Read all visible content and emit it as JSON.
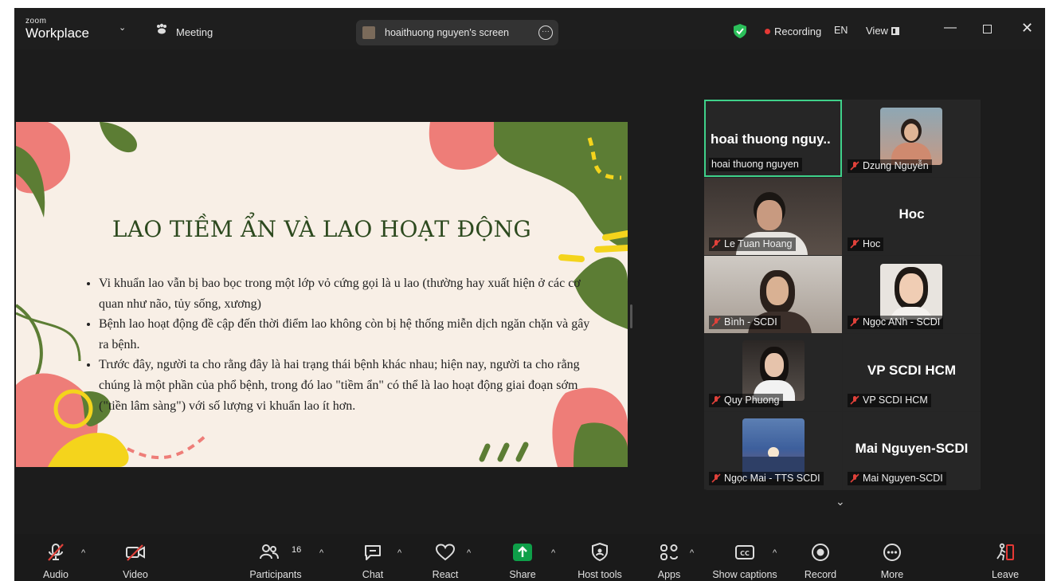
{
  "app": {
    "logo_small": "zoom",
    "logo_big": "Workplace",
    "meeting_label": "Meeting",
    "share_status": "hoaithuong nguyen's screen",
    "recording_label": "Recording",
    "language": "EN",
    "view_label": "View"
  },
  "slide": {
    "title": "LAO TIỀM ẨN VÀ LAO HOẠT ĐỘNG",
    "bullets": [
      "Vi khuẩn lao vẫn bị bao bọc trong một lớp vỏ cứng gọi là u lao (thường hay xuất hiện ở các cơ quan như não, tủy sống, xương)",
      "Bệnh lao hoạt động đề cập đến thời điểm lao không còn bị hệ thống miễn dịch ngăn chặn và gây ra bệnh.",
      "Trước đây, người ta cho rằng đây là hai trạng thái bệnh khác nhau; hiện nay, người ta cho rằng chúng là một phần của phổ bệnh, trong đó lao \"tiềm ẩn\" có thể là lao hoạt động giai đoạn sớm (\"tiền lâm sàng\") với số lượng vi khuẩn lao ít hơn."
    ]
  },
  "participants": [
    {
      "name": "hoai thuong nguyen",
      "namecard": "hoai thuong nguy..",
      "muted": false,
      "active": true
    },
    {
      "name": "Dzung Nguyễn",
      "muted": true
    },
    {
      "name": "Le Tuan Hoang",
      "muted": true
    },
    {
      "name": "Hoc",
      "namecard": "Hoc",
      "muted": true
    },
    {
      "name": "Bình - SCDI",
      "muted": true
    },
    {
      "name": "Ngọc ANh - SCDI",
      "muted": true
    },
    {
      "name": "Quy Phuong",
      "muted": true
    },
    {
      "name": "VP SCDI HCM",
      "namecard": "VP SCDI HCM",
      "muted": true
    },
    {
      "name": "Ngọc Mai - TTS SCDI",
      "muted": true
    },
    {
      "name": "Mai Nguyen-SCDI",
      "namecard": "Mai Nguyen-SCDI",
      "muted": true
    }
  ],
  "toolbar": {
    "audio": "Audio",
    "video": "Video",
    "participants": "Participants",
    "participants_count": "16",
    "chat": "Chat",
    "react": "React",
    "share": "Share",
    "host_tools": "Host tools",
    "apps": "Apps",
    "captions": "Show captions",
    "record": "Record",
    "more": "More",
    "leave": "Leave"
  },
  "colors": {
    "accent_green": "#3fd18a",
    "share_green": "#0e9f49",
    "leave_red": "#e53935",
    "muted_red": "#e0413a",
    "slide_title": "#2d4a1f"
  }
}
